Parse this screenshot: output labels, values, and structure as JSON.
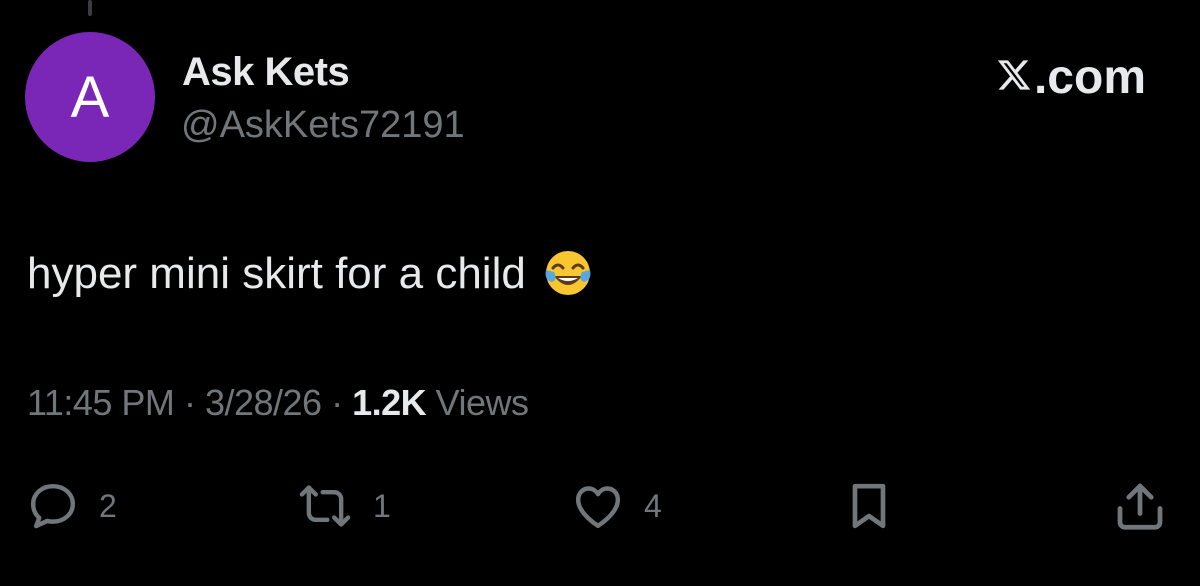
{
  "author": {
    "avatar_letter": "A",
    "name": "Ask Kets",
    "handle": "@AskKets72191"
  },
  "brand": {
    "label": ".com",
    "icon": "x-logo-icon"
  },
  "tweet": {
    "text": "hyper mini skirt for a child",
    "emoji": "face-with-tears-of-joy"
  },
  "meta": {
    "time": "11:45 PM",
    "separator": "·",
    "date": "3/28/26",
    "views_count": "1.2K",
    "views_label": "Views"
  },
  "actions": {
    "reply": {
      "icon": "reply-icon",
      "count": "2"
    },
    "repost": {
      "icon": "repost-icon",
      "count": "1"
    },
    "like": {
      "icon": "heart-icon",
      "count": "4"
    },
    "bookmark": {
      "icon": "bookmark-icon"
    },
    "share": {
      "icon": "share-icon"
    }
  },
  "colors": {
    "background": "#000000",
    "avatar": "#7a27b8",
    "primary_text": "#e7e9ea",
    "secondary_text": "#71767b"
  }
}
